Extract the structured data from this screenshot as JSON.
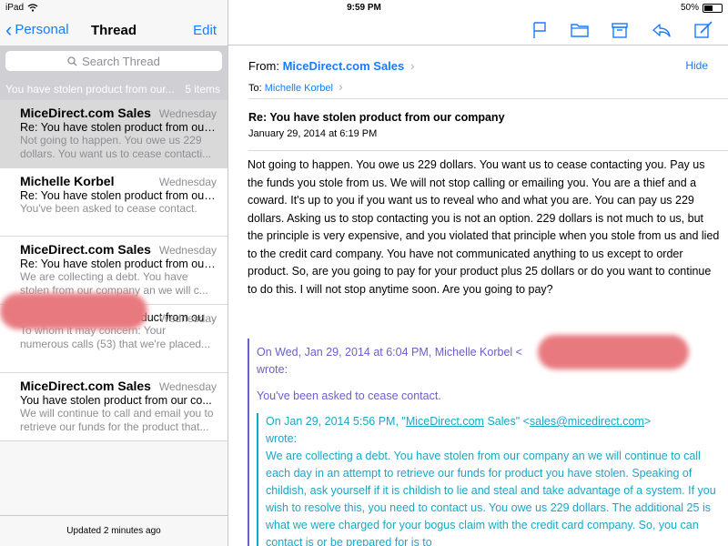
{
  "status_bar": {
    "device": "iPad",
    "time": "9:59 PM",
    "battery_text": "50%",
    "battery_level": 0.5
  },
  "left_nav": {
    "back_label": "Personal",
    "title": "Thread",
    "edit_label": "Edit"
  },
  "search": {
    "placeholder": "Search Thread"
  },
  "thread_header": {
    "subject": "You have stolen product from our...",
    "count": "5 items"
  },
  "messages": [
    {
      "sender": "MiceDirect.com Sales",
      "date": "Wednesday",
      "subject": "Re: You have stolen product from our...",
      "preview": "Not going to happen. You owe us 229 dollars. You want us to cease contacti..."
    },
    {
      "sender": "Michelle Korbel",
      "date": "Wednesday",
      "subject": "Re: You have stolen product from our...",
      "preview": "You've been asked to cease contact."
    },
    {
      "sender": "MiceDirect.com Sales",
      "date": "Wednesday",
      "subject": "Re: You have stolen product from our...",
      "preview": "We are collecting a debt. You have stolen from our company an we will c..."
    },
    {
      "sender": "",
      "date": "Wednesday",
      "subject": "Re: You have stolen product from our...",
      "preview": "To whom it may concern: Your numerous calls (53) that we're placed..."
    },
    {
      "sender": "MiceDirect.com Sales",
      "date": "Wednesday",
      "subject": "You have stolen product from our co...",
      "preview": "We will continue to call and email you to retrieve our funds for the product that..."
    }
  ],
  "left_footer": {
    "status": "Updated 2 minutes ago"
  },
  "toolbar": {
    "icons": [
      "flag-icon",
      "folder-icon",
      "archive-icon",
      "reply-icon",
      "compose-icon"
    ]
  },
  "email": {
    "from_label": "From:",
    "from_name": "MiceDirect.com Sales",
    "hide_label": "Hide",
    "to_label": "To:",
    "to_name": "Michelle Korbel",
    "subject": "Re: You have stolen product from our company",
    "date": "January 29, 2014 at 6:19 PM",
    "body": "Not going to happen.  You owe us 229 dollars.  You want us to cease contacting you.  Pay us the funds you stole from us.  We will not stop calling or emailing you.  You are a thief and a coward.  It's up to you if you want us to reveal who and what you are.  You can pay us 229 dollars.  Asking us to stop contacting you is not an option.  229 dollars is not much to us, but the principle is very expensive, and you violated that principle when you stole from us and lied to the credit card company.  You have not communicated anything to us except to order product.  So, are you going to pay for your product plus 25 dollars or do you want to continue to do this.  I will not stop anytime soon.  Are you going to pay?",
    "quote1_header": "On Wed, Jan 29, 2014 at 6:04 PM, Michelle Korbel <",
    "quote1_wrote": "wrote:",
    "quote1_text": "You've been asked to cease contact.",
    "quote2_header_pre": "On Jan 29, 2014 5:56 PM, \"",
    "quote2_header_name": "MiceDirect.com",
    "quote2_header_mid": " Sales\" <",
    "quote2_header_email": "sales@micedirect.com",
    "quote2_header_post": ">",
    "quote2_wrote": "wrote:",
    "quote2_text": "We are collecting a debt. You have stolen from our company an we will continue to call each day in an attempt to retrieve our funds for product you have stolen. Speaking of childish, ask yourself if it is childish to lie and steal and take advantage of a system.  If you wish to resolve this, you need to contact us. You owe us 229 dollars. The additional 25 is what we were charged for your bogus claim with the credit card company. So, you can contact is or be prepared for is to"
  },
  "colors": {
    "accent": "#1a7bff",
    "quote1": "#6a5fcd",
    "quote2": "#19a7c7",
    "redaction": "#e87a7f"
  }
}
